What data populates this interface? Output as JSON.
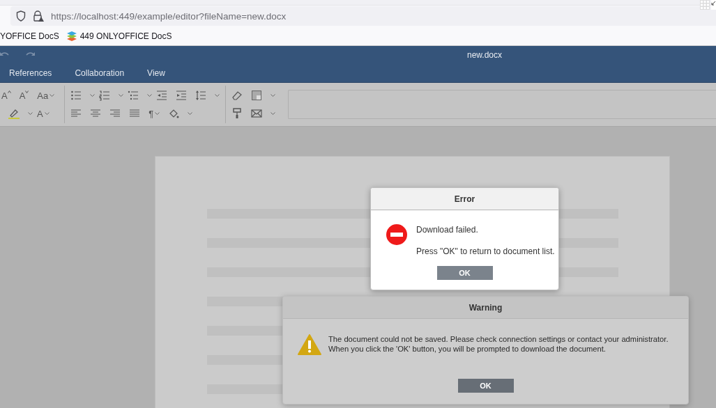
{
  "browser": {
    "url": "https://localhost:449/example/editor?fileName=new.docx",
    "bookmarks": [
      "YOFFICE DocS",
      "449 ONLYOFFICE DocS"
    ]
  },
  "editor": {
    "title": "new.docx",
    "tabs": [
      {
        "label": "References",
        "selected": false
      },
      {
        "label": "Collaboration",
        "selected": false
      },
      {
        "label": "View",
        "selected": false
      }
    ]
  },
  "toolbar": {
    "grow_font": "A",
    "shrink_font": "A",
    "change_case": "Aa",
    "font_color": "A",
    "nonprinting": "¶"
  },
  "dialogs": [
    {
      "kind": "error",
      "title": "Error",
      "lines": [
        "Download failed.",
        "Press \"OK\" to return to document list."
      ],
      "button": "OK"
    },
    {
      "kind": "warning",
      "title": "Warning",
      "lines": [
        "The document could not be saved. Please check connection settings or contact your administrator.",
        "When you click the 'OK' button, you will be prompted to download the document."
      ],
      "button": "OK"
    }
  ]
}
